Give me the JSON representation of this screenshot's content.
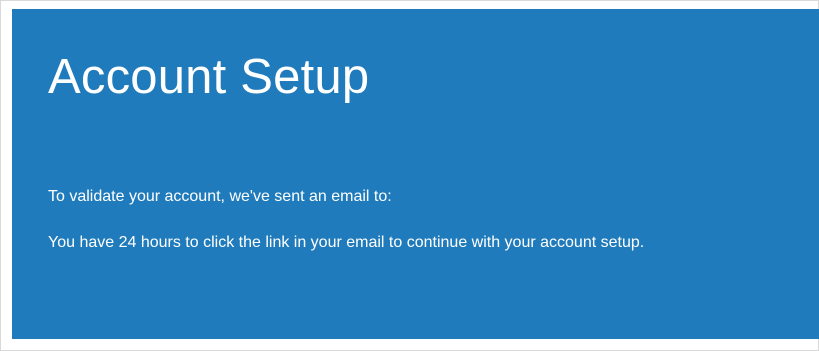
{
  "panel": {
    "title": "Account Setup",
    "validate_message": "To validate your account, we've sent an email to:",
    "email": "",
    "deadline_message": "You have 24 hours to click the link in your email to continue with your account setup."
  },
  "colors": {
    "panel_background": "#1f7bbb",
    "text": "#ffffff",
    "page_background": "#ffffff",
    "frame_border": "#d9d9d9"
  }
}
